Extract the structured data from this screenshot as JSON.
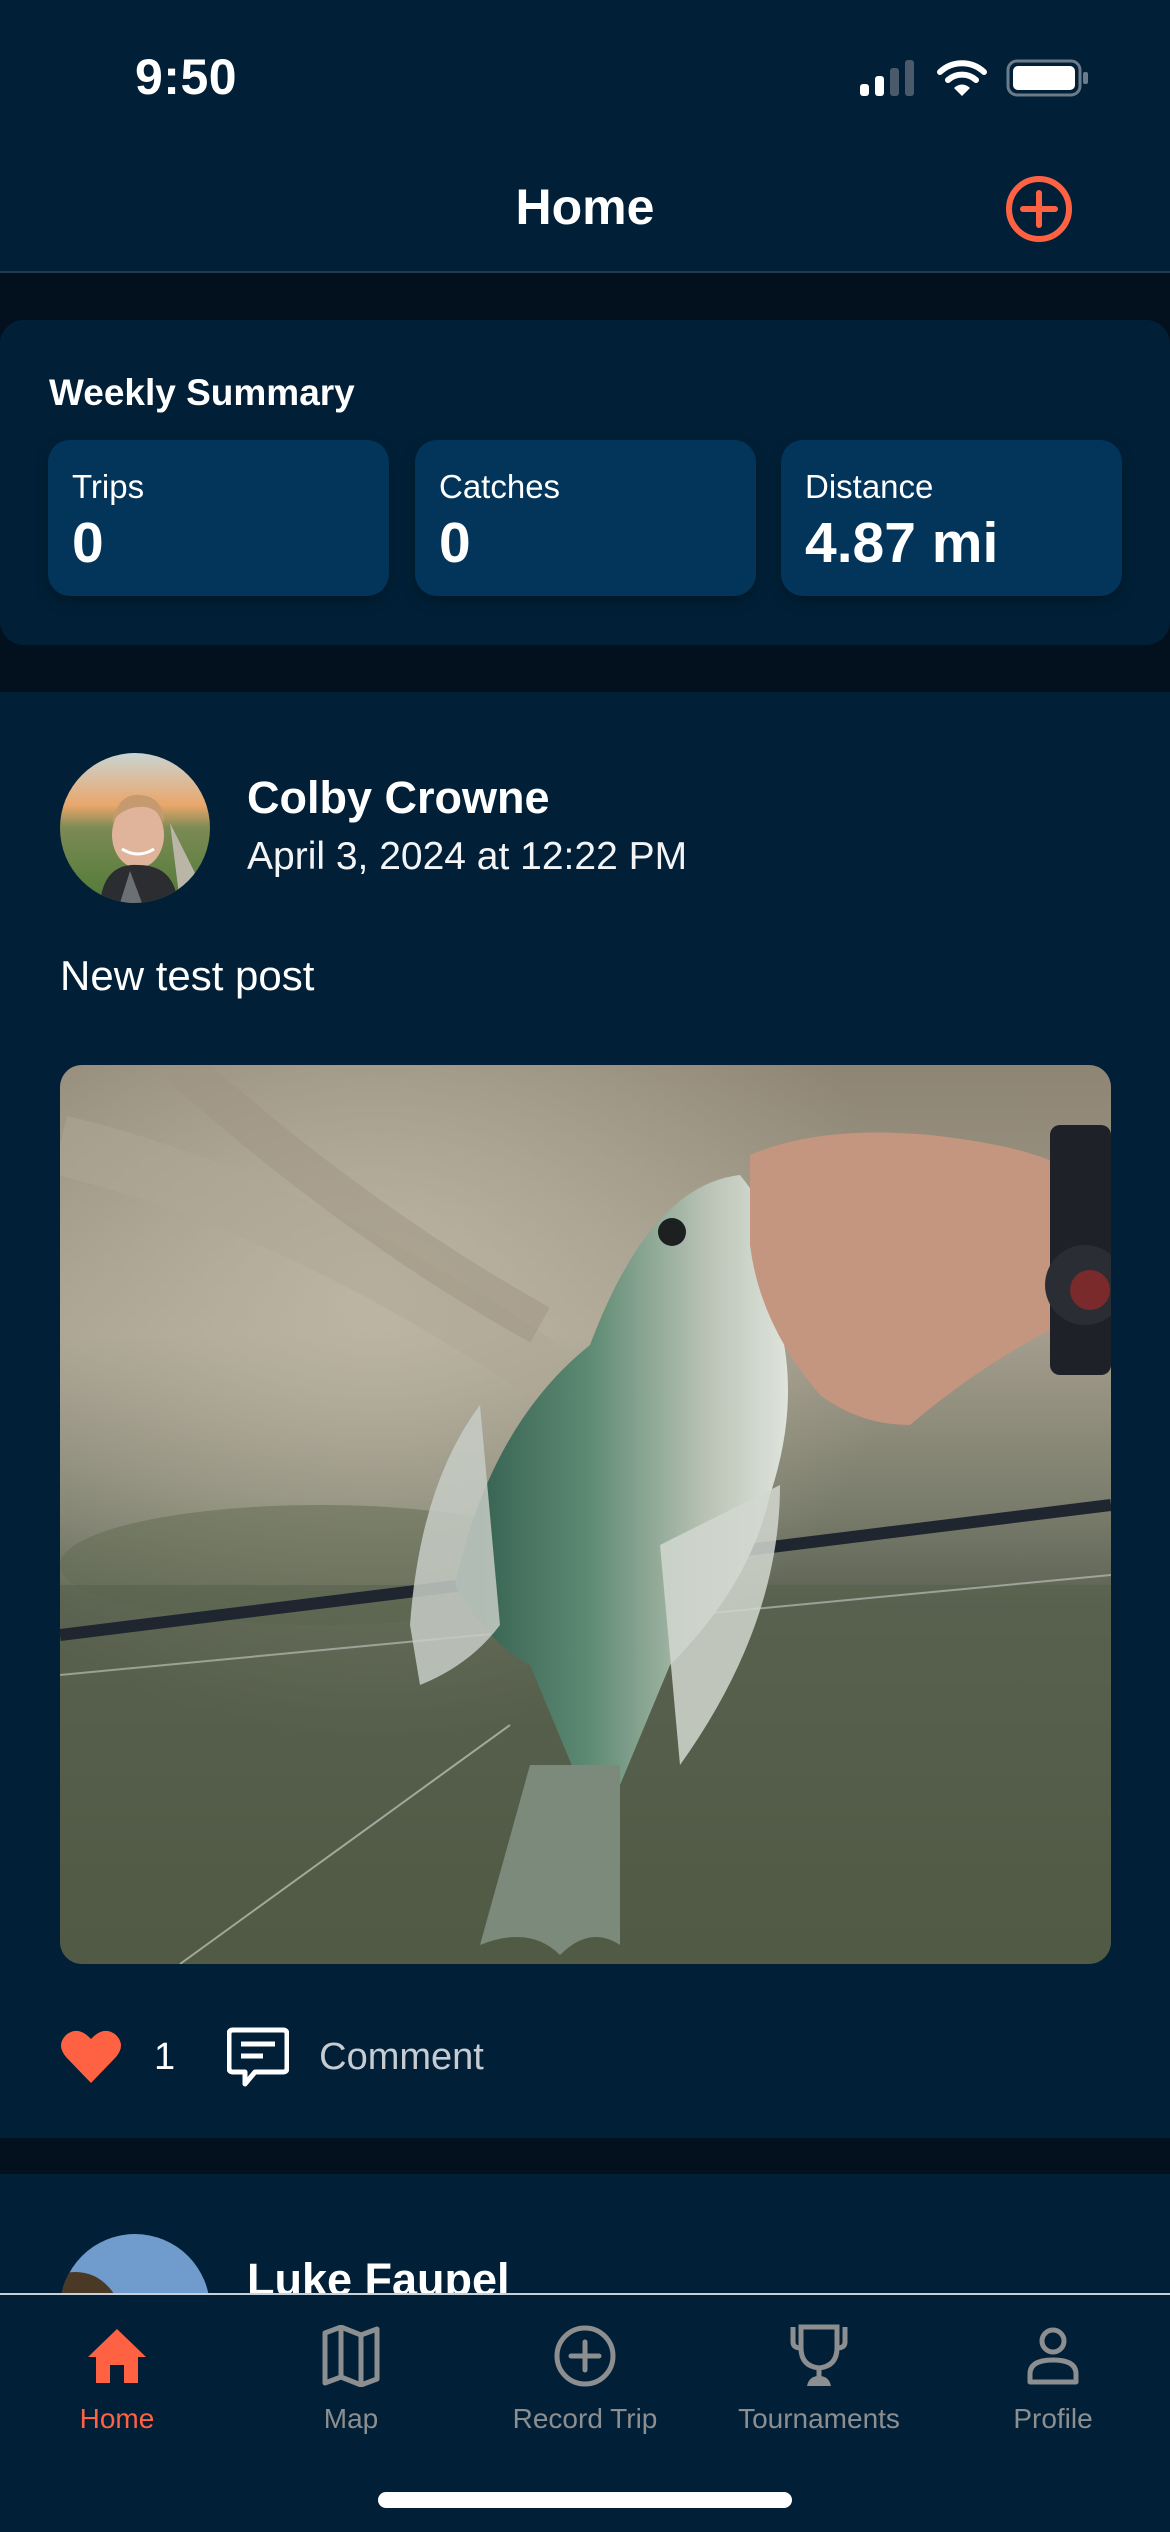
{
  "status_bar": {
    "time": "9:50",
    "icons": [
      "signal-icon",
      "wifi-icon",
      "battery-icon"
    ]
  },
  "header": {
    "title": "Home",
    "add_button_icon": "plus-circle-icon"
  },
  "colors": {
    "accent": "#ff6243",
    "background": "#012037",
    "separator": "#03111f",
    "stat_box": "#03355a",
    "tab_inactive": "#8c8e90"
  },
  "weekly_summary": {
    "title": "Weekly Summary",
    "stats": [
      {
        "label": "Trips",
        "value": "0"
      },
      {
        "label": "Catches",
        "value": "0"
      },
      {
        "label": "Distance",
        "value": "4.87 mi"
      }
    ]
  },
  "feed": {
    "posts": [
      {
        "author": "Colby Crowne",
        "date": "April 3, 2024 at 12:22 PM",
        "text": "New test post",
        "image_icon": "crappie-fish-photo",
        "likes": "1",
        "liked": true,
        "comment_label": "Comment"
      },
      {
        "author": "Luke Faupel"
      }
    ]
  },
  "tab_bar": {
    "active": "Home",
    "tabs": [
      {
        "label": "Home",
        "icon": "home-icon"
      },
      {
        "label": "Map",
        "icon": "map-icon"
      },
      {
        "label": "Record Trip",
        "icon": "plus-circle-icon"
      },
      {
        "label": "Tournaments",
        "icon": "trophy-icon"
      },
      {
        "label": "Profile",
        "icon": "person-icon"
      }
    ]
  }
}
